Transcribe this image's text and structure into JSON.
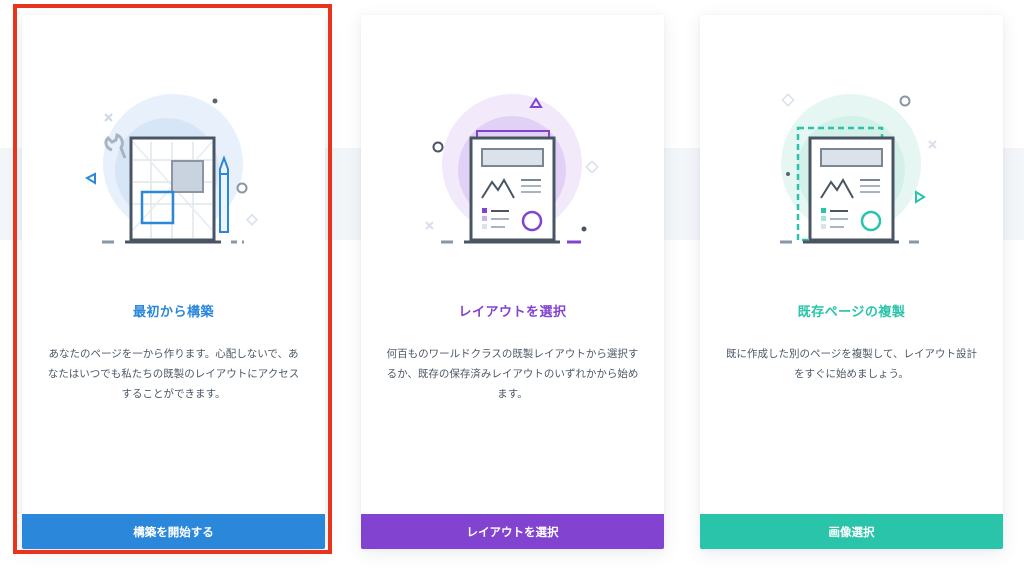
{
  "colors": {
    "blue": "#2b87da",
    "purple": "#8143d0",
    "teal": "#29c4a9",
    "selection_border": "#e9341d",
    "desc_text": "#4c5866"
  },
  "selected_card": "build-from-scratch",
  "cards": [
    {
      "id": "build-from-scratch",
      "title": "最初から構築",
      "description": "あなたのページを一から作ります。心配しないで、あなたはいつでも私たちの既製のレイアウトにアクセスすることができます。",
      "button_label": "構築を開始する",
      "accent": "#2b87da",
      "illustration": "wireframe-grid-with-wrench-and-pencil-icon"
    },
    {
      "id": "choose-layout",
      "title": "レイアウトを選択",
      "description": "何百ものワールドクラスの既製レイアウトから選択するか、既存の保存済みレイアウトのいずれかから始めます。",
      "button_label": "レイアウトを選択",
      "accent": "#8143d0",
      "illustration": "layout-pages-stack-icon"
    },
    {
      "id": "clone-page",
      "title": "既存ページの複製",
      "description": "既に作成した別のページを複製して、レイアウト設計をすぐに始めましょう。",
      "button_label": "画像選択",
      "accent": "#29c4a9",
      "illustration": "duplicate-page-icon"
    }
  ]
}
